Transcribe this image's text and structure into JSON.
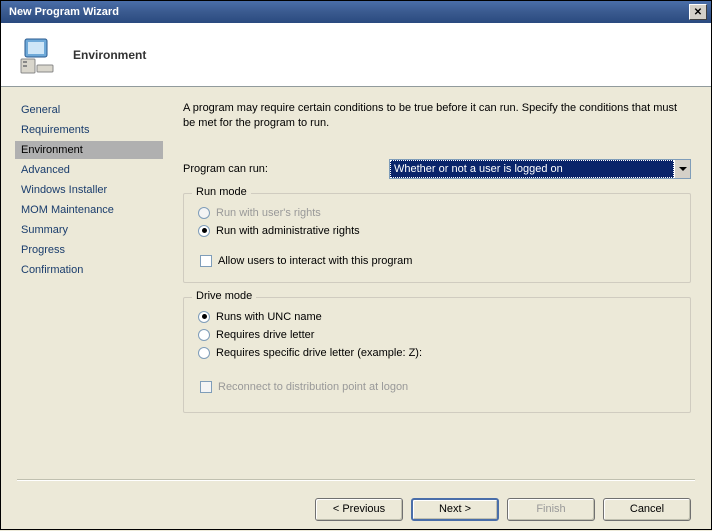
{
  "window": {
    "title": "New Program Wizard"
  },
  "header": {
    "page_title": "Environment"
  },
  "sidebar": {
    "items": [
      {
        "label": "General",
        "active": false
      },
      {
        "label": "Requirements",
        "active": false
      },
      {
        "label": "Environment",
        "active": true
      },
      {
        "label": "Advanced",
        "active": false
      },
      {
        "label": "Windows Installer",
        "active": false
      },
      {
        "label": "MOM Maintenance",
        "active": false
      },
      {
        "label": "Summary",
        "active": false
      },
      {
        "label": "Progress",
        "active": false
      },
      {
        "label": "Confirmation",
        "active": false
      }
    ]
  },
  "content": {
    "intro": "A program may require certain conditions to be true before it can run. Specify the conditions that must be met for the program to run.",
    "program_can_run_label": "Program can run:",
    "program_can_run_value": "Whether or not a user is logged on",
    "run_mode": {
      "title": "Run mode",
      "opt_user_rights": "Run with user's rights",
      "opt_admin_rights": "Run with administrative rights",
      "selected": "admin",
      "allow_interact": "Allow users to interact with this program",
      "allow_interact_checked": false
    },
    "drive_mode": {
      "title": "Drive mode",
      "opt_unc": "Runs with UNC name",
      "opt_drive_letter": "Requires drive letter",
      "opt_specific": "Requires specific drive letter (example: Z):",
      "selected": "unc",
      "reconnect": "Reconnect to distribution point at logon",
      "reconnect_checked": false
    }
  },
  "footer": {
    "previous": "< Previous",
    "next": "Next >",
    "finish": "Finish",
    "cancel": "Cancel"
  }
}
